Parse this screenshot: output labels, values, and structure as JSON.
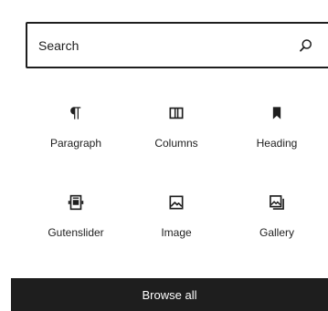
{
  "search": {
    "placeholder": "Search",
    "icon": "search-icon"
  },
  "blocks": [
    {
      "label": "Paragraph",
      "icon": "paragraph-icon"
    },
    {
      "label": "Columns",
      "icon": "columns-icon"
    },
    {
      "label": "Heading",
      "icon": "bookmark-icon"
    },
    {
      "label": "Gutenslider",
      "icon": "slider-icon"
    },
    {
      "label": "Image",
      "icon": "image-icon"
    },
    {
      "label": "Gallery",
      "icon": "gallery-icon"
    }
  ],
  "footer": {
    "browse_all_label": "Browse all"
  },
  "colors": {
    "text": "#1e1e1e",
    "background": "#ffffff",
    "button_bg": "#1e1e1e",
    "button_text": "#ffffff"
  }
}
